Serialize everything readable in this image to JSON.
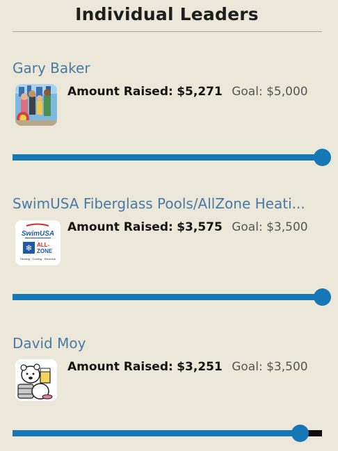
{
  "header": {
    "title": "Individual Leaders"
  },
  "colors": {
    "background": "#ece8d9",
    "name_link": "#4a79a6",
    "progress": "#1578b5",
    "track_overflow": "#0d0d0d"
  },
  "leaders": [
    {
      "name": "Gary Baker",
      "avatar": "photo-avatar",
      "raised_label": "Amount Raised:",
      "raised_value": "$5,271",
      "goal_label": "Goal:",
      "goal_value": "$5,000",
      "progress_fraction": 1.0
    },
    {
      "name": "SwimUSA Fiberglass Pools/AllZone Heati...",
      "avatar": "company-logo",
      "logo_text": {
        "brand1": "SwimUSA",
        "brand2_line1": "ALL-",
        "brand2_line2": "ZONE",
        "tagline": "Heating · Cooling · Electrical"
      },
      "raised_label": "Amount Raised:",
      "raised_value": "$3,575",
      "goal_label": "Goal:",
      "goal_value": "$3,500",
      "progress_fraction": 1.0
    },
    {
      "name": "David Moy",
      "avatar": "cartoon-bear-avatar",
      "raised_label": "Amount Raised:",
      "raised_value": "$3,251",
      "goal_label": "Goal:",
      "goal_value": "$3,500",
      "progress_fraction": 0.929
    }
  ]
}
